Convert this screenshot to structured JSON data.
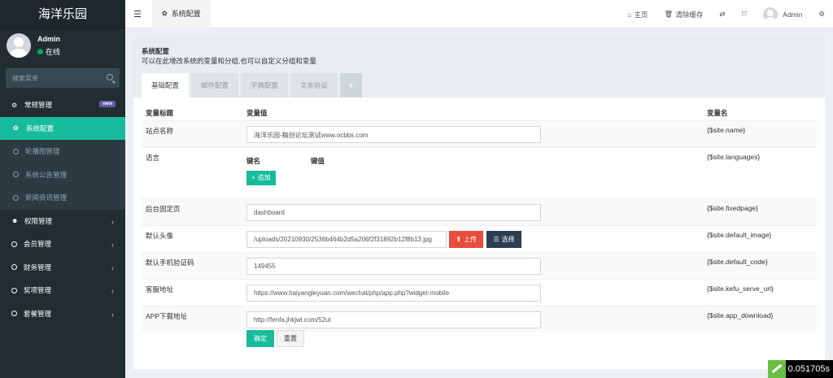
{
  "sidebar": {
    "logo": "海洋乐园",
    "user_name": "Admin",
    "user_status": "在线",
    "search_placeholder": "搜索菜单",
    "items": [
      {
        "label": "常规管理",
        "badge": "new"
      },
      {
        "label": "系统配置"
      },
      {
        "label": "轮播图管理"
      },
      {
        "label": "系统公告管理"
      },
      {
        "label": "新闻资讯管理"
      },
      {
        "label": "权限管理"
      },
      {
        "label": "会员管理"
      },
      {
        "label": "财务管理"
      },
      {
        "label": "奖项管理"
      },
      {
        "label": "套餐管理"
      }
    ]
  },
  "header": {
    "active_tab": "系统配置",
    "home": "主页",
    "clear_cache": "清除缓存",
    "user": "Admin"
  },
  "panel": {
    "title": "系统配置",
    "subtitle": "可以在此增改系统的变量和分组,也可以自定义分组和变量",
    "tabs": [
      "基础配置",
      "邮件配置",
      "字典配置",
      "文本协议",
      "+"
    ]
  },
  "table": {
    "headers": [
      "变量标题",
      "变量值",
      "变量名"
    ],
    "rows": [
      {
        "title": "站点名称",
        "value": "海洋乐园-稿创论坛测试www.ocbbs.com",
        "name": "{$site.name}"
      },
      {
        "title": "语言",
        "key_label": "键名",
        "val_label": "键值",
        "add": "追加",
        "name": "{$site.languages}"
      },
      {
        "title": "后台固定页",
        "value": "dashboard",
        "name": "{$site.fixedpage}"
      },
      {
        "title": "默认头像",
        "value": "/uploads/20210930/2536b464b2d5a206f2f31892b12f8b13.jpg",
        "upload": "上传",
        "choose": "选择",
        "name": "{$site.default_image}"
      },
      {
        "title": "默认手机验证码",
        "value": "149455",
        "name": "{$site.default_code}"
      },
      {
        "title": "客服地址",
        "value": "https://www.haiyangleyuan.com/wechat/php/app.php?widget-mobile",
        "name": "{$site.kefu_serve_url}"
      },
      {
        "title": "APP下载地址",
        "value": " http://fenfa.jhkjwl.com/52ut",
        "name": "{$site.app_download}"
      }
    ]
  },
  "actions": {
    "ok": "确定",
    "reset": "重置"
  },
  "timer": "0.051705s"
}
